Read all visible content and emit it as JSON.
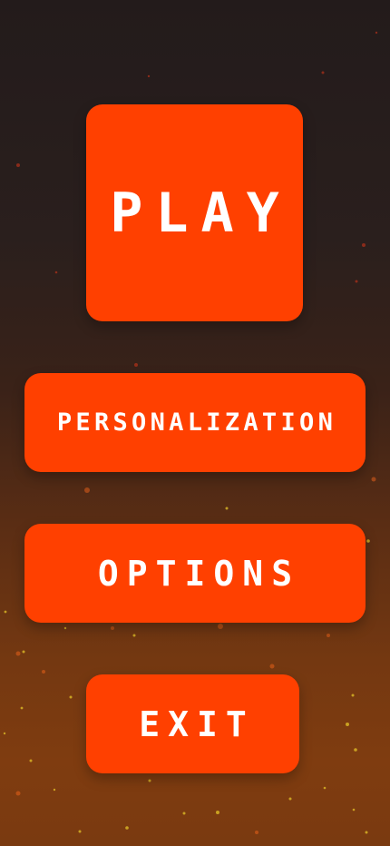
{
  "theme": {
    "button_color": "#ff4000",
    "text_color": "#ffffff"
  },
  "menu": {
    "play_label": "PLAY",
    "personalization_label": "PERSONALIZATION",
    "options_label": "OPTIONS",
    "exit_label": "EXIT"
  }
}
